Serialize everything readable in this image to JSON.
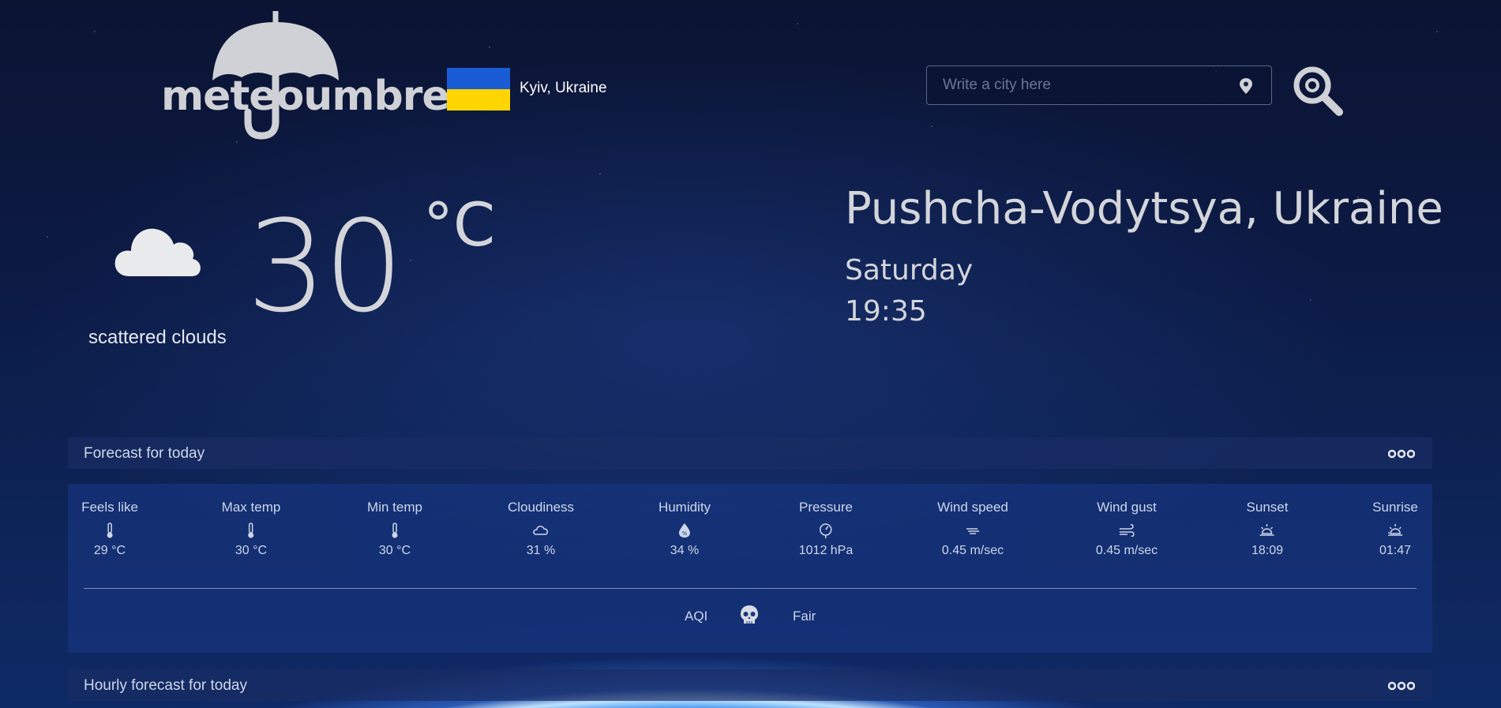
{
  "header": {
    "logo_text": "meteoumbrella",
    "flag_country": "Ukraine",
    "flag_colors": {
      "top": "#1a5bd6",
      "bottom": "#ffd500"
    },
    "user_location": "Kyiv, Ukraine",
    "search_placeholder": "Write a city here",
    "search_value": ""
  },
  "current": {
    "icon": "cloud-icon",
    "condition": "scattered clouds",
    "temperature": "30",
    "unit": "°C",
    "city": "Pushcha-Vodytsya, Ukraine",
    "day": "Saturday",
    "time": "19:35"
  },
  "forecast_today": {
    "title": "Forecast for today",
    "metrics": [
      {
        "label": "Feels like",
        "icon": "thermometer-icon",
        "value": "29 °C"
      },
      {
        "label": "Max temp",
        "icon": "thermometer-icon",
        "value": "30 °C"
      },
      {
        "label": "Min temp",
        "icon": "thermometer-icon",
        "value": "30 °C"
      },
      {
        "label": "Cloudiness",
        "icon": "cloud-icon",
        "value": "31 %"
      },
      {
        "label": "Humidity",
        "icon": "humidity-icon",
        "value": "34 %"
      },
      {
        "label": "Pressure",
        "icon": "pressure-icon",
        "value": "1012 hPa"
      },
      {
        "label": "Wind speed",
        "icon": "wind-icon",
        "value": "0.45 m/sec"
      },
      {
        "label": "Wind gust",
        "icon": "wind-gust-icon",
        "value": "0.45 m/sec"
      },
      {
        "label": "Sunset",
        "icon": "sunset-icon",
        "value": "18:09"
      },
      {
        "label": "Sunrise",
        "icon": "sunrise-icon",
        "value": "01:47"
      }
    ],
    "aqi_label": "AQI",
    "aqi_icon": "skull-icon",
    "aqi_value": "Fair"
  },
  "hourly": {
    "title": "Hourly forecast for today"
  }
}
